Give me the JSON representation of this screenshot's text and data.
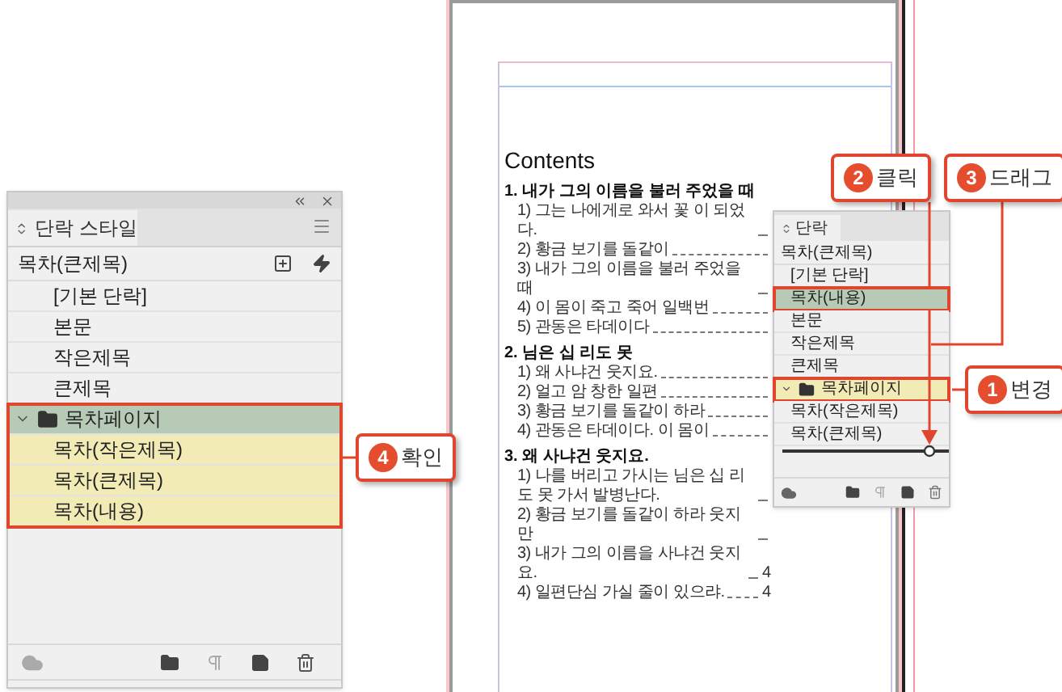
{
  "styles_panel": {
    "tab": "단락 스타일",
    "current_style": "목차(큰제목)",
    "items": [
      {
        "label": "[기본 단락]",
        "kind": "style",
        "selected": false,
        "highlighted": false
      },
      {
        "label": "본문",
        "kind": "style",
        "selected": false,
        "highlighted": false
      },
      {
        "label": "작은제목",
        "kind": "style",
        "selected": false,
        "highlighted": false
      },
      {
        "label": "큰제목",
        "kind": "style",
        "selected": false,
        "highlighted": false
      },
      {
        "label": "목차페이지",
        "kind": "group",
        "expanded": true,
        "selected": true,
        "outlined": true,
        "children": [
          {
            "label": "목차(작은제목)",
            "kind": "style",
            "selected": false,
            "highlighted": true
          },
          {
            "label": "목차(큰제목)",
            "kind": "style",
            "selected": false,
            "highlighted": true
          },
          {
            "label": "목차(내용)",
            "kind": "style",
            "selected": false,
            "highlighted": true
          }
        ]
      }
    ]
  },
  "document": {
    "title": "Contents",
    "sections": [
      {
        "heading": "1. 내가 그의 이름을 불러 주었을 때",
        "entries": [
          {
            "text": "1) 그는 나에게로 와서 꽃 이 되었다."
          },
          {
            "text": "2) 황금 보기를 돌같이"
          },
          {
            "text": "3) 내가 그의 이름을 불러 주었을 때"
          },
          {
            "text": "4) 이 몸이 죽고 죽어 일백번"
          },
          {
            "text": "5) 관동은 타데이다"
          }
        ]
      },
      {
        "heading": "2. 님은 십 리도 못",
        "entries": [
          {
            "text": "1) 왜 사냐건 웃지요."
          },
          {
            "text": "2) 얼고 암 창한 일편"
          },
          {
            "text": "3) 황금 보기를 돌같이 하라"
          },
          {
            "text": "4) 관동은 타데이다. 이 몸이"
          }
        ]
      },
      {
        "heading": "3. 왜 사냐건 웃지요.",
        "entries": [
          {
            "text": "1) 나를 버리고 가시는 님은 십 리도 못 가서 발병난다."
          },
          {
            "text": "2) 황금 보기를 돌같이 하라 웃지만"
          },
          {
            "text": "3) 내가 그의 이름을 사냐건 웃지요.",
            "page": "4"
          },
          {
            "text": "4) 일편단심 가실 줄이 있으랴.",
            "page": "4"
          }
        ]
      }
    ]
  },
  "mini_panel": {
    "tab": "단락",
    "current_style": "목차(큰제목)",
    "items": [
      {
        "label": "[기본 단락]",
        "kind": "style",
        "selected": false,
        "highlighted": false,
        "outlined": false
      },
      {
        "label": "목차(내용)",
        "kind": "style",
        "selected": true,
        "outlined": true
      },
      {
        "label": "본문",
        "kind": "style",
        "selected": false,
        "highlighted": false,
        "outlined": false
      },
      {
        "label": "작은제목",
        "kind": "style",
        "selected": false,
        "highlighted": false,
        "outlined": false
      },
      {
        "label": "큰제목",
        "kind": "style",
        "selected": false,
        "highlighted": false,
        "outlined": false
      },
      {
        "label": "목차페이지",
        "kind": "group",
        "expanded": true,
        "selected": false,
        "highlighted": true,
        "outlined": true,
        "children": [
          {
            "label": "목차(작은제목)",
            "kind": "style",
            "selected": false,
            "highlighted": false,
            "outlined": false
          },
          {
            "label": "목차(큰제목)",
            "kind": "style",
            "selected": false,
            "highlighted": false,
            "outlined": false
          }
        ]
      }
    ]
  },
  "callouts": [
    {
      "number": "1",
      "label": "변경"
    },
    {
      "number": "2",
      "label": "클릭"
    },
    {
      "number": "3",
      "label": "드래그"
    },
    {
      "number": "4",
      "label": "확인"
    }
  ]
}
